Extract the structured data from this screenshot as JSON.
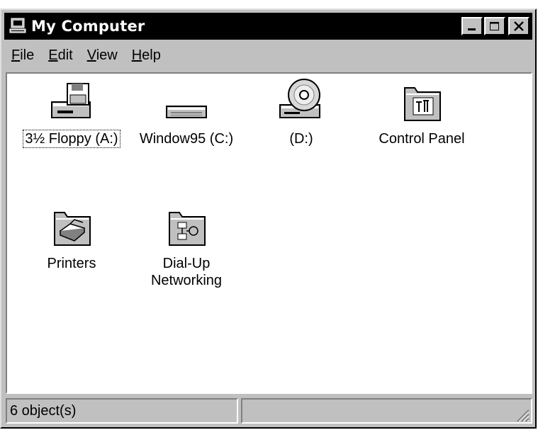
{
  "window": {
    "title": "My Computer",
    "title_icon": "computer-icon",
    "caption_buttons": [
      "minimize",
      "maximize",
      "close"
    ]
  },
  "menu": {
    "items": [
      {
        "first": "F",
        "rest": "ile"
      },
      {
        "first": "E",
        "rest": "dit"
      },
      {
        "first": "V",
        "rest": "iew"
      },
      {
        "first": "H",
        "rest": "elp"
      }
    ]
  },
  "icons": [
    {
      "label": "3½ Floppy (A:)",
      "icon": "floppy-drive-icon"
    },
    {
      "label": "Window95 (C:)",
      "icon": "hard-drive-icon"
    },
    {
      "label": "(D:)",
      "icon": "cd-drive-icon"
    },
    {
      "label": "Control Panel",
      "icon": "control-panel-folder-icon"
    },
    {
      "label": "Printers",
      "icon": "printers-folder-icon"
    },
    {
      "label": "Dial-Up\nNetworking",
      "icon": "dialup-networking-folder-icon"
    }
  ],
  "status": {
    "count_text": "6 object(s)",
    "second_pane": ""
  },
  "colors": {
    "face": "#c0c0c0",
    "titlebar": "#000000",
    "content": "#ffffff"
  }
}
